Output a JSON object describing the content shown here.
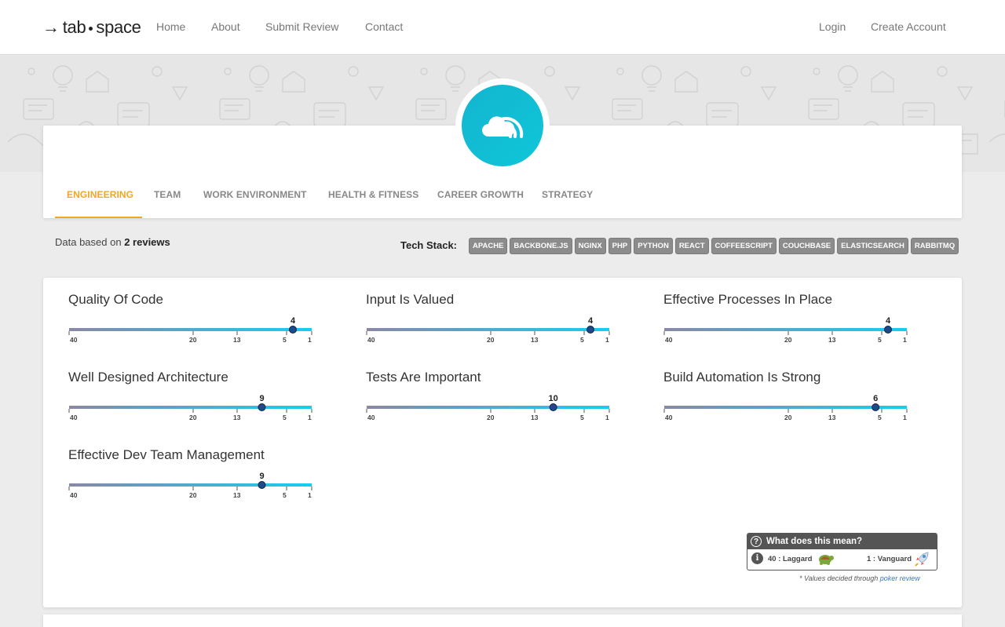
{
  "navbar": {
    "logo": {
      "part1": "tab",
      "part2": "space"
    },
    "links": [
      "Home",
      "About",
      "Submit Review",
      "Contact"
    ],
    "auth": [
      "Login",
      "Create Account"
    ]
  },
  "tabs": [
    "ENGINEERING",
    "TEAM",
    "WORK ENVIRONMENT",
    "HEALTH & FITNESS",
    "CAREER GROWTH",
    "STRATEGY"
  ],
  "summary": {
    "prefix": "Data based on",
    "count_text": "2 reviews",
    "tech_label": "Tech Stack:",
    "tech_stack": [
      "APACHE",
      "BACKBONE.JS",
      "NGINX",
      "PHP",
      "PYTHON",
      "REACT",
      "COFFEESCRIPT",
      "COUCHBASE",
      "ELASTICSEARCH",
      "RABBITMQ"
    ]
  },
  "scale_ticks": [
    40,
    20,
    13,
    5,
    1
  ],
  "metrics": [
    {
      "title": "Quality Of Code",
      "value": 4
    },
    {
      "title": "Input Is Valued",
      "value": 4
    },
    {
      "title": "Effective Processes In Place",
      "value": 4
    },
    {
      "title": "Well Designed Architecture",
      "value": 9
    },
    {
      "title": "Tests Are Important",
      "value": 10
    },
    {
      "title": "Build Automation Is Strong",
      "value": 6
    },
    {
      "title": "Effective Dev Team Management",
      "value": 9
    }
  ],
  "legend": {
    "title": "What does this mean?",
    "laggard": "40 : Laggard",
    "vanguard": "1 : Vanguard"
  },
  "footnote": {
    "text": "* Values decided through",
    "link": "poker review"
  },
  "colors": {
    "accent": "#f0a721",
    "scale_start": "#8a88a6",
    "scale_end": "#16cdf2",
    "marker": "#1c4a8a",
    "logo_bg": "#13b5cf"
  }
}
